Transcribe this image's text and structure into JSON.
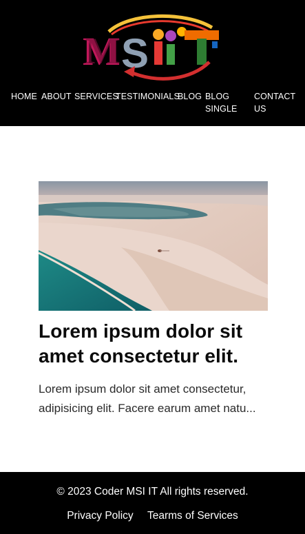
{
  "header": {
    "logo_text": "MSIIT",
    "nav": [
      {
        "label": "HOME"
      },
      {
        "label": "ABOUT"
      },
      {
        "label": "SERVICES"
      },
      {
        "label": "TESTIMONIALS"
      },
      {
        "label": "BLOG"
      },
      {
        "label": "BLOG SINGLE"
      },
      {
        "label": "CONTACT US"
      }
    ]
  },
  "main": {
    "card": {
      "title": "Lorem ipsum dolor sit amet consectetur elit.",
      "text": "Lorem ipsum dolor sit amet consectetur, adipisicing elit. Facere earum amet natu..."
    }
  },
  "footer": {
    "copyright": "© 2023 Coder MSI IT All rights reserved.",
    "links": [
      {
        "label": "Privacy Policy"
      },
      {
        "label": "Tearms of Services"
      }
    ]
  },
  "colors": {
    "header_bg": "#000000",
    "footer_bg": "#000000",
    "page_bg": "#ffffff",
    "text_dark": "#0b0b0b"
  }
}
